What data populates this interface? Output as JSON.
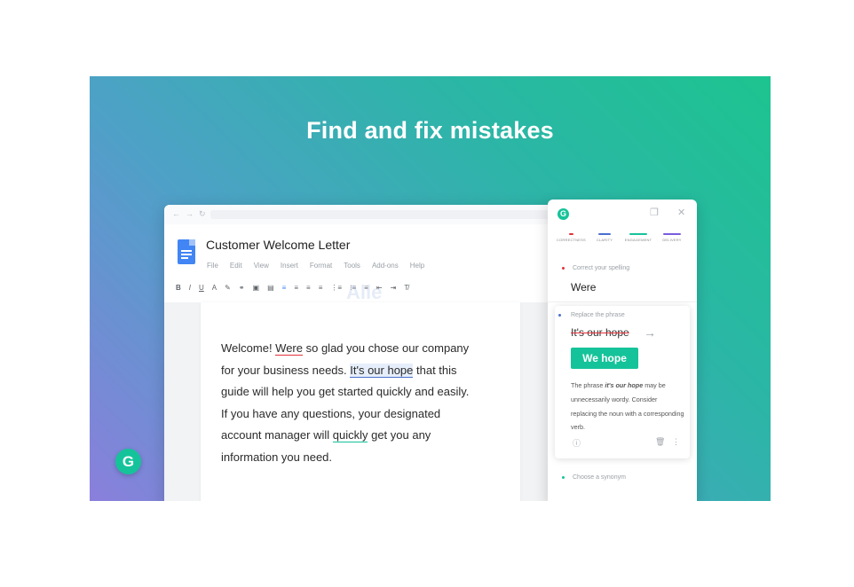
{
  "hero": {
    "title": "Find and fix mistakes"
  },
  "browser": {
    "nav": {
      "back": "←",
      "forward": "→",
      "refresh": "↻"
    }
  },
  "doc": {
    "title": "Customer Welcome Letter",
    "menu": [
      "File",
      "Edit",
      "View",
      "Insert",
      "Format",
      "Tools",
      "Add-ons",
      "Help"
    ],
    "toolbar": [
      "B",
      "I",
      "U",
      "A",
      "✎",
      "⚭",
      "▣",
      "▤",
      "≡",
      "≡",
      "≡",
      "≡",
      "⋮≡",
      "⁝≡",
      "≡",
      "⇤",
      "⇥",
      "T̸"
    ],
    "body": {
      "l1a": "Welcome! ",
      "l1_err": "Were",
      "l1b": " so glad you chose our company",
      "l2a": "for your business needs. ",
      "l2_err": "It's our hope",
      "l2b": " that this",
      "l3": "guide will help you get started quickly and easily.",
      "l4": "If you have any questions, your designated",
      "l5a": "account manager will ",
      "l5_err": "quickly",
      "l5b": " get you any",
      "l6": "information you need."
    },
    "watermark": "Alle"
  },
  "panel": {
    "logo": "G",
    "categories": [
      {
        "label": "CORRECTNESS",
        "color": "#e2313a"
      },
      {
        "label": "CLARITY",
        "color": "#4a6fd0"
      },
      {
        "label": "ENGAGEMENT",
        "color": "#15c39a"
      },
      {
        "label": "DELIVERY",
        "color": "#7a5ce0"
      }
    ],
    "suggestion1": {
      "label": "Correct your spelling",
      "word": "Were",
      "dot_color": "#e2313a"
    },
    "suggestion2": {
      "label": "Replace the phrase",
      "original": "It's our hope",
      "fix": "We hope",
      "explain_a": "The phrase ",
      "explain_em": "it's our hope",
      "explain_b": " may be unnecessarily wordy. Consider replacing the noun with a corresponding verb.",
      "dot_color": "#4a6fd0"
    },
    "suggestion3": {
      "label": "Choose a synonym",
      "dot_color": "#15c39a"
    }
  },
  "badge": {
    "logo": "G"
  }
}
